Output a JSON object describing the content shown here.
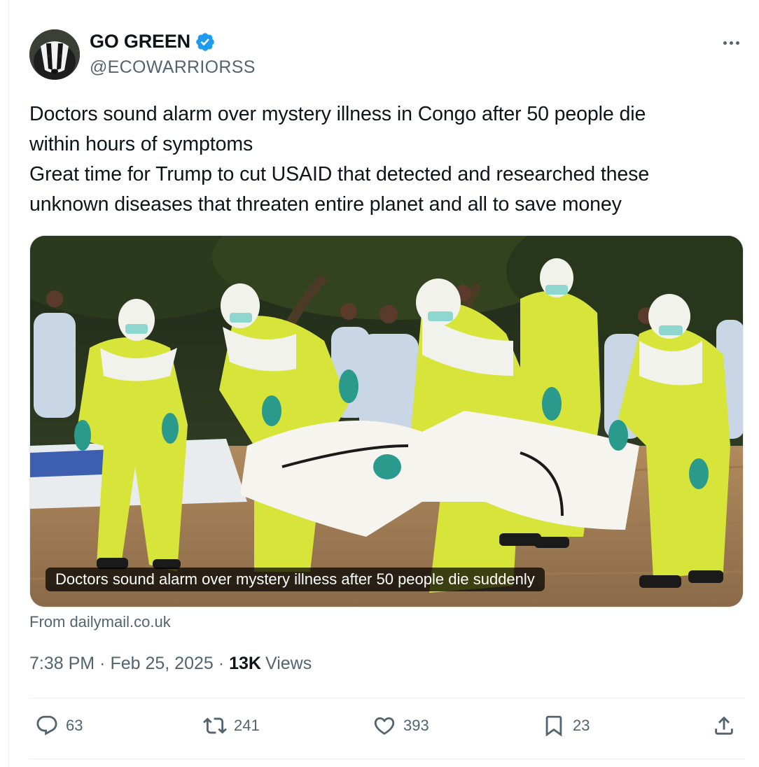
{
  "author": {
    "display_name": "GO GREEN",
    "handle": "@ECOWARRIORSS",
    "verified": true,
    "verified_color": "#1d9bf0"
  },
  "tweet": {
    "lines": [
      "Doctors sound alarm over mystery illness in Congo after 50 people die",
      "within hours of symptoms",
      "Great time for Trump to cut USAID that detected and researched these",
      "unknown diseases that threaten entire planet and all to save money"
    ]
  },
  "card": {
    "caption": "Doctors sound alarm over mystery illness after 50 people die suddenly",
    "source": "From dailymail.co.uk"
  },
  "meta": {
    "time": "7:38 PM",
    "separator": "·",
    "date": "Feb 25, 2025",
    "views_count": "13K",
    "views_label": "Views"
  },
  "actions": {
    "replies": "63",
    "reposts": "241",
    "likes": "393",
    "bookmarks": "23"
  },
  "icons": {
    "more": "more-icon",
    "reply": "reply-icon",
    "repost": "repost-icon",
    "like": "heart-icon",
    "bookmark": "bookmark-icon",
    "share": "share-icon"
  },
  "colors": {
    "text_secondary": "#536471",
    "suit_yellow": "#d7e43a",
    "glove_teal": "#2a9a8c"
  }
}
